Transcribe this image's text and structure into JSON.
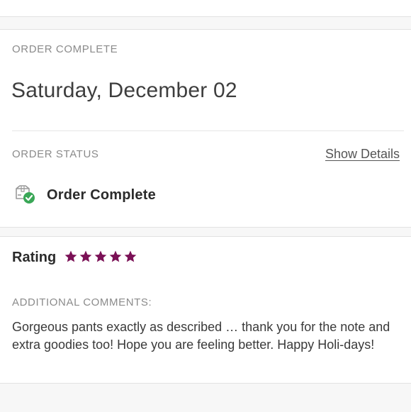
{
  "order": {
    "complete_label": "ORDER COMPLETE",
    "date": "Saturday, December 02",
    "status_label": "ORDER STATUS",
    "show_details": "Show Details",
    "status_value": "Order Complete"
  },
  "rating": {
    "label": "Rating",
    "stars": 5,
    "max_stars": 5,
    "star_color": "#7b1156"
  },
  "comments": {
    "label": "ADDITIONAL COMMENTS:",
    "text": "Gorgeous pants exactly as described … thank you for the note and extra goodies too! Hope you are feeling better. Happy Holi-days!"
  },
  "colors": {
    "check_badge": "#3aa757"
  }
}
